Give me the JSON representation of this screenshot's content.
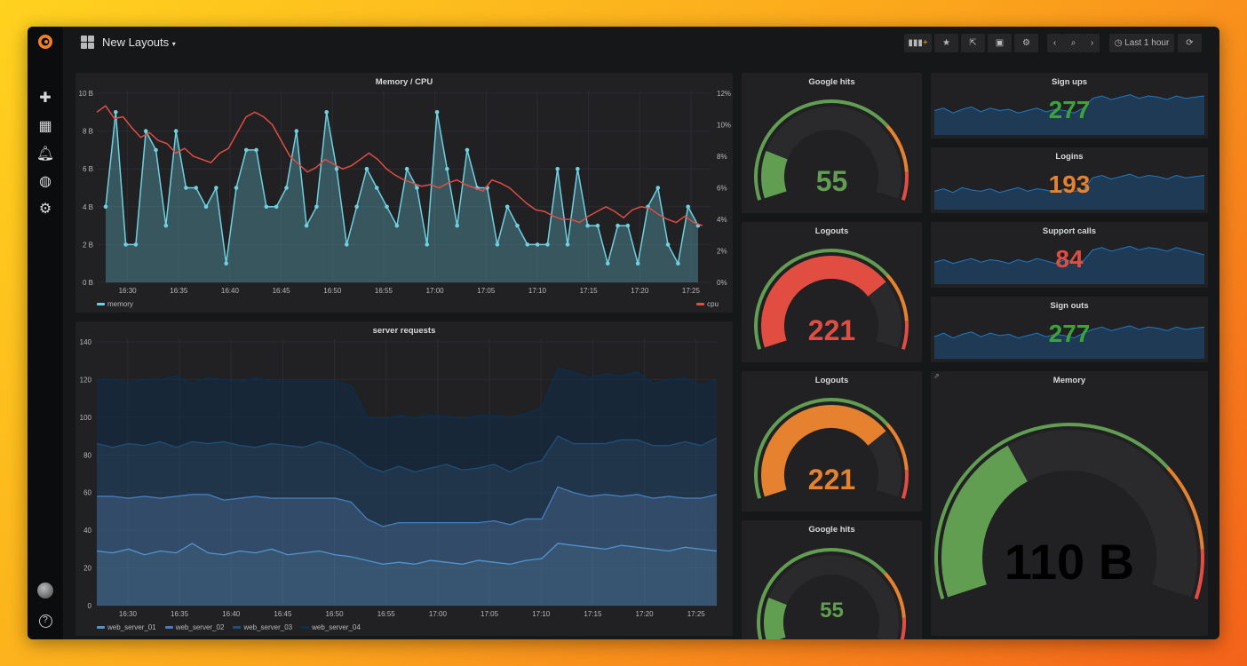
{
  "header": {
    "title": "New Layouts",
    "time_range": "Last 1 hour"
  },
  "toolbar": [
    "add-panel",
    "star",
    "share",
    "save",
    "settings",
    "prev",
    "zoom-out",
    "next",
    "time-picker",
    "refresh"
  ],
  "sidebar": {
    "items": [
      "create",
      "dashboards",
      "alerting",
      "explore",
      "configuration"
    ],
    "bottom": [
      "profile",
      "help"
    ],
    "help_glyph": "?"
  },
  "colors": {
    "green": "#629e51",
    "orange": "#e5812f",
    "red": "#e24d42",
    "memory": "#6ed0e0",
    "cpu": "#e24d42",
    "bluefill": "#1f3a55"
  },
  "memory_cpu": {
    "title": "Memory / CPU",
    "time": {
      "start": "16:27",
      "end": "17:27",
      "ticks": [
        "16:30",
        "16:35",
        "16:40",
        "16:45",
        "16:50",
        "16:55",
        "17:00",
        "17:05",
        "17:10",
        "17:15",
        "17:20",
        "17:25"
      ]
    },
    "left_ticks": [
      "0 B",
      "2 B",
      "4 B",
      "6 B",
      "8 B",
      "10 B"
    ],
    "left_max": 10,
    "right_ticks": [
      "0%",
      "2%",
      "4%",
      "6%",
      "8%",
      "10%",
      "12%"
    ],
    "right_max": 12,
    "memory": {
      "name": "memory",
      "values": [
        4,
        9,
        2,
        2,
        8,
        7,
        3,
        8,
        5,
        5,
        4,
        5,
        1,
        5,
        7,
        7,
        4,
        4,
        5,
        8,
        3,
        4,
        9,
        6,
        2,
        4,
        6,
        5,
        4,
        3,
        6,
        5,
        2,
        9,
        6,
        3,
        7,
        5,
        5,
        2,
        4,
        3,
        2,
        2,
        2,
        6,
        2,
        6,
        3,
        3,
        1,
        3,
        3,
        1,
        4,
        5,
        2,
        1,
        4,
        3
      ]
    },
    "cpu": {
      "name": "cpu",
      "values": [
        10.8,
        11.2,
        10.4,
        10.5,
        9.8,
        9.2,
        9.5,
        9,
        8.8,
        8.2,
        8.5,
        8,
        7.8,
        7.6,
        8.2,
        8.5,
        9.5,
        10.5,
        10.8,
        10.5,
        10,
        9,
        8,
        7.5,
        7,
        7.3,
        7.8,
        7.5,
        7.2,
        7.4,
        7.8,
        8.2,
        7.8,
        7.2,
        6.8,
        6.5,
        6.3,
        6.1,
        6.2,
        6,
        6.3,
        6.5,
        6.2,
        6,
        5.8,
        6.5,
        6.3,
        6,
        5.5,
        5,
        4.6,
        4.5,
        4.2,
        4,
        4,
        3.8,
        4.2,
        4.5,
        4.8,
        4.5,
        4.1,
        4.6,
        4.8,
        4.7,
        4.3,
        4,
        3.8,
        4.2,
        3.8,
        3.6
      ]
    }
  },
  "server_requests": {
    "title": "server requests",
    "stacked": true,
    "y_max": 140,
    "y_ticks": [
      "0",
      "20",
      "40",
      "60",
      "80",
      "100",
      "120",
      "140"
    ],
    "series": [
      {
        "name": "web_server_01",
        "color": "#5195ce",
        "values": [
          29,
          28,
          30,
          27,
          29,
          28,
          33,
          28,
          27,
          29,
          28,
          30,
          27,
          28,
          29,
          27,
          26,
          24,
          22,
          23,
          22,
          24,
          23,
          22,
          24,
          23,
          22,
          24,
          25,
          33,
          32,
          31,
          30,
          32,
          31,
          30,
          29,
          31,
          30,
          29
        ]
      },
      {
        "name": "web_server_02",
        "color": "#447ebc",
        "values": [
          29,
          30,
          27,
          31,
          28,
          30,
          26,
          31,
          29,
          28,
          30,
          27,
          30,
          29,
          28,
          30,
          29,
          22,
          20,
          21,
          22,
          20,
          21,
          22,
          20,
          22,
          21,
          22,
          21,
          30,
          28,
          27,
          29,
          26,
          28,
          27,
          29,
          26,
          27,
          30
        ]
      },
      {
        "name": "web_server_03",
        "color": "#1f4e78",
        "values": [
          28,
          26,
          29,
          27,
          30,
          26,
          28,
          27,
          31,
          28,
          26,
          29,
          28,
          27,
          30,
          28,
          26,
          28,
          29,
          30,
          27,
          29,
          31,
          28,
          29,
          30,
          28,
          29,
          31,
          27,
          26,
          28,
          27,
          30,
          29,
          28,
          27,
          30,
          28,
          30
        ]
      },
      {
        "name": "web_server_04",
        "color": "#0a2f4f",
        "values": [
          34,
          36,
          32,
          35,
          33,
          38,
          31,
          35,
          33,
          34,
          37,
          33,
          34,
          35,
          32,
          34,
          36,
          26,
          28,
          27,
          29,
          28,
          26,
          27,
          28,
          26,
          29,
          27,
          28,
          36,
          38,
          35,
          37,
          34,
          36,
          33,
          35,
          34,
          32,
          31
        ]
      }
    ]
  },
  "gauges": [
    {
      "title": "Google hits",
      "value": "55",
      "num": 55,
      "min": 0,
      "max": 300,
      "color": "#629e51"
    },
    {
      "title": "Logouts",
      "value": "221",
      "num": 221,
      "min": 0,
      "max": 300,
      "color": "#e24d42"
    },
    {
      "title": "Logouts",
      "value": "221",
      "num": 221,
      "min": 0,
      "max": 300,
      "color": "#e5812f"
    },
    {
      "title": "Google hits",
      "value": "55",
      "num": 55,
      "min": 0,
      "max": 300,
      "color": "#629e51"
    }
  ],
  "gauge_thresholds": [
    {
      "upto": 0.72,
      "color": "#629e51"
    },
    {
      "upto": 0.9,
      "color": "#e5812f"
    },
    {
      "upto": 1,
      "color": "#e24d42"
    }
  ],
  "memory_gauge": {
    "title": "Memory",
    "value": "110 B",
    "num": 110,
    "min": 0,
    "max": 300,
    "color": "#629e51"
  },
  "singlestats": [
    {
      "title": "Sign ups",
      "value": "277",
      "color": "#3aa33a",
      "spark": [
        60,
        62,
        58,
        61,
        63,
        59,
        62,
        60,
        61,
        58,
        60,
        62,
        59,
        61,
        60,
        58,
        62,
        70,
        72,
        69,
        71,
        73,
        70,
        72,
        71,
        69,
        72,
        70,
        71,
        72
      ]
    },
    {
      "title": "Logins",
      "value": "193",
      "color": "#e5812f",
      "spark": [
        55,
        57,
        54,
        58,
        56,
        55,
        57,
        54,
        56,
        58,
        55,
        57,
        56,
        54,
        57,
        55,
        56,
        66,
        68,
        65,
        67,
        69,
        66,
        68,
        67,
        65,
        68,
        66,
        67,
        68
      ]
    },
    {
      "title": "Support calls",
      "value": "84",
      "color": "#e24d42",
      "spark": [
        58,
        60,
        57,
        59,
        61,
        58,
        60,
        59,
        57,
        60,
        58,
        61,
        59,
        57,
        60,
        58,
        59,
        68,
        70,
        67,
        69,
        71,
        68,
        70,
        69,
        67,
        70,
        68,
        66,
        64
      ]
    },
    {
      "title": "Sign outs",
      "value": "277",
      "color": "#3aa33a",
      "spark": [
        58,
        61,
        57,
        60,
        62,
        58,
        61,
        59,
        60,
        57,
        59,
        61,
        58,
        60,
        59,
        57,
        61,
        64,
        66,
        63,
        65,
        67,
        64,
        66,
        65,
        63,
        66,
        64,
        65,
        66
      ]
    }
  ]
}
